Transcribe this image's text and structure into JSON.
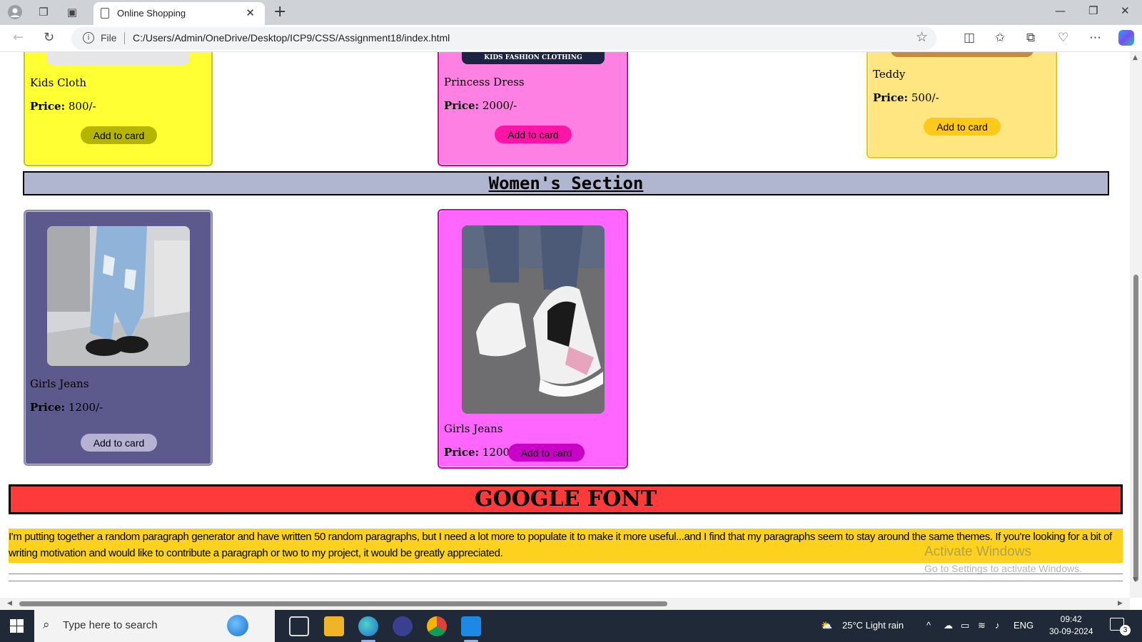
{
  "browser": {
    "tab_title": "Online Shopping",
    "address_file_label": "File",
    "url": "C:/Users/Admin/OneDrive/Desktop/ICP9/CSS/Assignment18/index.html"
  },
  "kids_products": [
    {
      "name": "Kids Cloth",
      "price_label": "Price:",
      "price": "800/-",
      "button": "Add to card",
      "bg": "#ffff33",
      "border": "#c9c900",
      "btn_color": "#b5b500"
    },
    {
      "name": "Princess Dress",
      "price_label": "Price:",
      "price": "2000/-",
      "button": "Add to card",
      "bg": "#ff80e3",
      "border": "#e0009e",
      "btn_color": "#ff14a8",
      "banner": "KIDS FASHION CLOTHING"
    },
    {
      "name": "Teddy",
      "price_label": "Price:",
      "price": "500/-",
      "button": "Add to card",
      "bg": "#ffe680",
      "border": "#f3c800",
      "btn_color": "#ffc91a"
    }
  ],
  "women_section": {
    "title": "Women's Section",
    "products": [
      {
        "name": "Girls Jeans",
        "price_label": "Price:",
        "price": "1200/-",
        "button": "Add to card",
        "bg": "#5c5a8c",
        "border": "#8a88b8",
        "btn_color": "#b5b2d4",
        "image_icon": "jeans-photo"
      },
      {
        "name": "Girls Jeans",
        "price_label": "Price:",
        "price": "1200/-",
        "button": "Add to card",
        "bg": "#ff66ff",
        "border": "#d600b5",
        "btn_color": "#c800c8",
        "image_icon": "sneakers-photo"
      }
    ]
  },
  "google_font": {
    "title": "GOOGLE FONT",
    "paragraph": "I'm putting together a random paragraph generator and have written 50 random paragraphs, but I need a lot more to populate it to make it more useful...and I find that my paragraphs seem to stay around the same themes. If you're looking for a bit of writing motivation and would like to contribute a paragraph or two to my project, it would be greatly appreciated."
  },
  "watermark": {
    "line1": "Activate Windows",
    "line2": "Go to Settings to activate Windows."
  },
  "taskbar": {
    "search_placeholder": "Type here to search",
    "weather": "25°C  Light rain",
    "language": "ENG",
    "time": "09:42",
    "date": "30-09-2024",
    "notification_count": "3"
  }
}
